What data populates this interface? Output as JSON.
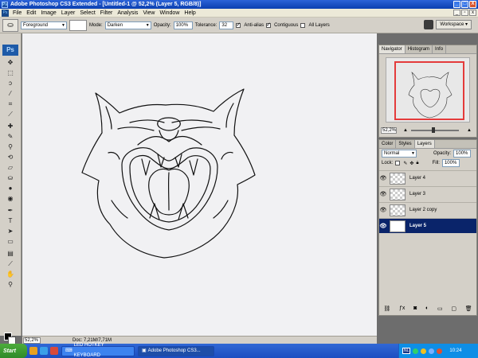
{
  "window": {
    "title": "Adobe Photoshop CS3 Extended - [Untitled-1 @ 52,2% (Layer 5, RGB/8)]",
    "minimize": "_",
    "maximize": "□",
    "close": "X"
  },
  "menu": {
    "items": [
      "File",
      "Edit",
      "Image",
      "Layer",
      "Select",
      "Filter",
      "Analysis",
      "View",
      "Window",
      "Help"
    ]
  },
  "options": {
    "fill_source": "Foreground",
    "mode_label": "Mode:",
    "mode_value": "Darken",
    "opacity_label": "Opacity:",
    "opacity_value": "100%",
    "tolerance_label": "Tolerance:",
    "tolerance_value": "32",
    "antialias_label": "Anti-alias",
    "contiguous_label": "Contiguous",
    "all_layers_label": "All Layers",
    "workspace_label": "Workspace ▾"
  },
  "tools": {
    "logo": "Ps"
  },
  "document": {
    "zoom": "52,2%",
    "doc_info": "Doc: 7,21M/7,71M"
  },
  "navigator": {
    "tabs": [
      "Navigator",
      "Histogram",
      "Info"
    ],
    "zoom": "52,2%"
  },
  "color_panel": {
    "tabs": [
      "Color",
      "Styles",
      "Layers"
    ]
  },
  "layers": {
    "blend_mode": "Normal",
    "opacity_label": "Opacity:",
    "opacity_value": "100%",
    "lock_label": "Lock:",
    "fill_label": "Fill:",
    "fill_value": "100%",
    "rows": [
      {
        "name": "Layer 4",
        "selected": false
      },
      {
        "name": "Layer 3",
        "selected": false
      },
      {
        "name": "Layer 2 copy",
        "selected": false
      },
      {
        "name": "Layer 5",
        "selected": true
      }
    ]
  },
  "taskbar": {
    "start": "Start",
    "task1": "LED HOTKEY KEYBOARD",
    "task2": "Adobe Photoshop CS3...",
    "lang": "NL",
    "clock": "10:24"
  }
}
